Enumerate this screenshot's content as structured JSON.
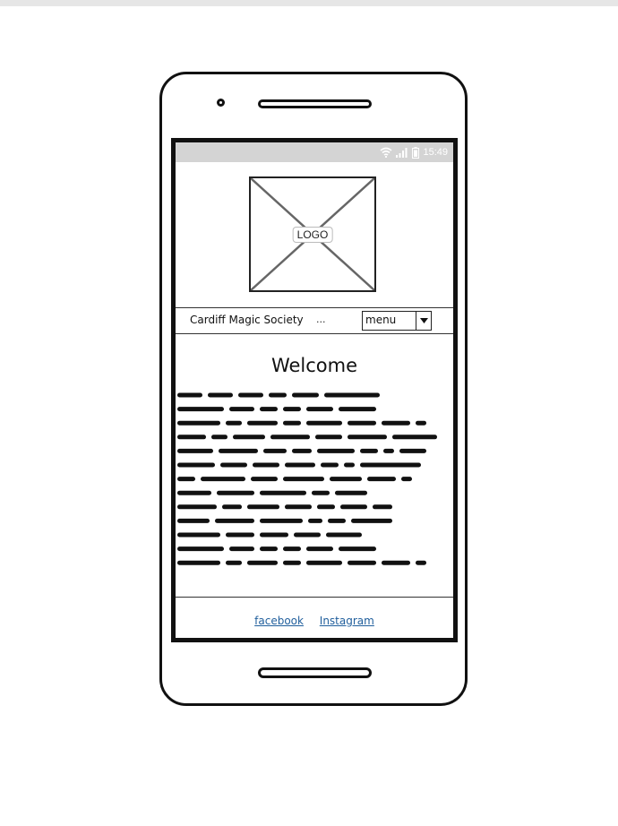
{
  "status_bar": {
    "time": "15:49"
  },
  "logo": {
    "label": "LOGO"
  },
  "navbar": {
    "site_name": "Cardiff Magic Society",
    "ellipsis": "...",
    "menu": {
      "selected": "menu"
    }
  },
  "main": {
    "heading": "Welcome"
  },
  "footer": {
    "links": [
      {
        "label": "facebook"
      },
      {
        "label": "Instagram"
      }
    ]
  },
  "colors": {
    "status_bar_bg": "#d4d4d4",
    "link": "#1f5e9c"
  }
}
